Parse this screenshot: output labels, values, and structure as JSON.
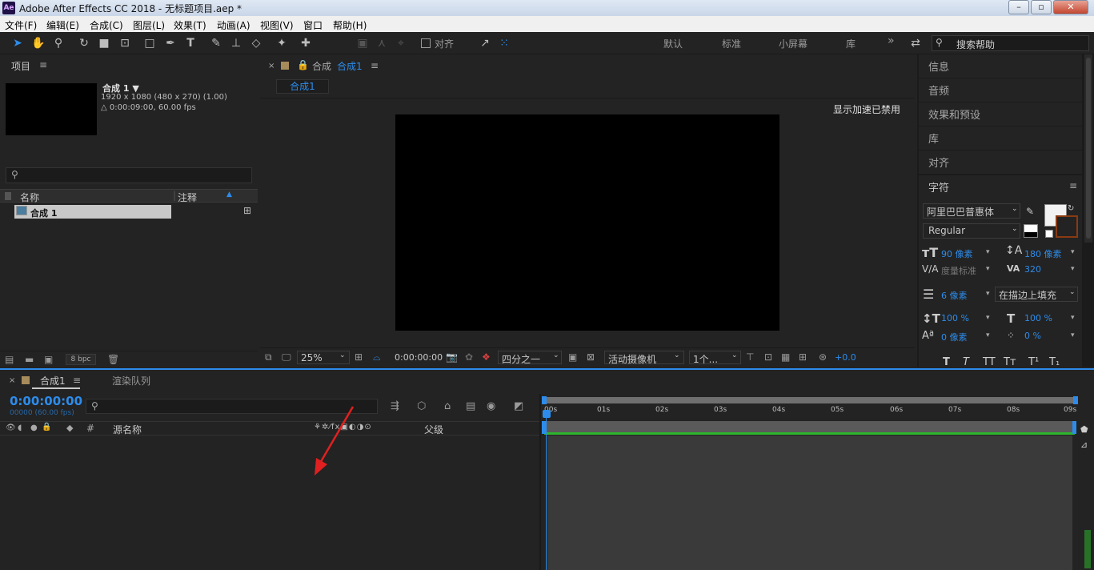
{
  "titlebar": {
    "app_title": "Adobe After Effects CC 2018 - 无标题项目.aep *",
    "app_icon": "Ae"
  },
  "menu": [
    "文件(F)",
    "编辑(E)",
    "合成(C)",
    "图层(L)",
    "效果(T)",
    "动画(A)",
    "视图(V)",
    "窗口",
    "帮助(H)"
  ],
  "toolbar": {
    "align_label": "对齐",
    "workspaces": [
      "默认",
      "标准",
      "小屏幕",
      "库"
    ],
    "more": "»",
    "search_placeholder": "搜索帮助"
  },
  "project": {
    "title": "项目",
    "comp_name": "合成 1 ▼",
    "comp_size": "1920 x 1080  (480 x 270) (1.00)",
    "comp_duration": "△ 0:00:09:00, 60.00 fps",
    "col_name": "名称",
    "col_comment": "注释",
    "item_name": "合成 1",
    "bpc": "8 bpc"
  },
  "composition": {
    "panel_prefix": "合成",
    "panel_name": "合成1",
    "tab_label": "合成1",
    "accel_message": "显示加速已禁用",
    "zoom": "25%",
    "time": "0:00:00:00",
    "resolution": "四分之一",
    "camera": "活动摄像机",
    "views": "1个...",
    "exposure": "+0.0"
  },
  "right_panels": [
    "信息",
    "音频",
    "效果和预设",
    "库",
    "对齐"
  ],
  "character": {
    "title": "字符",
    "font_family": "阿里巴巴普惠体",
    "font_style": "Regular",
    "font_size": "90 像素",
    "leading": "180 像素",
    "kerning": "度量标准",
    "tracking": "320",
    "stroke_width": "6 像素",
    "stroke_mode": "在描边上填充",
    "vertical_scale": "100 %",
    "horizontal_scale": "100 %",
    "baseline_shift": "0 像素",
    "tsume": "0 %",
    "style_buttons": [
      "T",
      "T",
      "TT",
      "Tт",
      "T¹",
      "T₁"
    ],
    "fill_color": "#f2f2f2",
    "stroke_color": "#8a3a12"
  },
  "timeline": {
    "comp_tab": "合成1",
    "render_tab": "渲染队列",
    "timecode": "0:00:00:00",
    "frames": "00000 (60.00 fps)",
    "col_hash": "#",
    "col_source_name": "源名称",
    "col_parent": "父级",
    "ruler": [
      "00s",
      "01s",
      "02s",
      "03s",
      "04s",
      "05s",
      "06s",
      "07s",
      "08s",
      "09s"
    ]
  },
  "colors": {
    "accent": "#2d8ceb",
    "work_area": "#2db52d",
    "annotation_arrow": "#e02020"
  }
}
